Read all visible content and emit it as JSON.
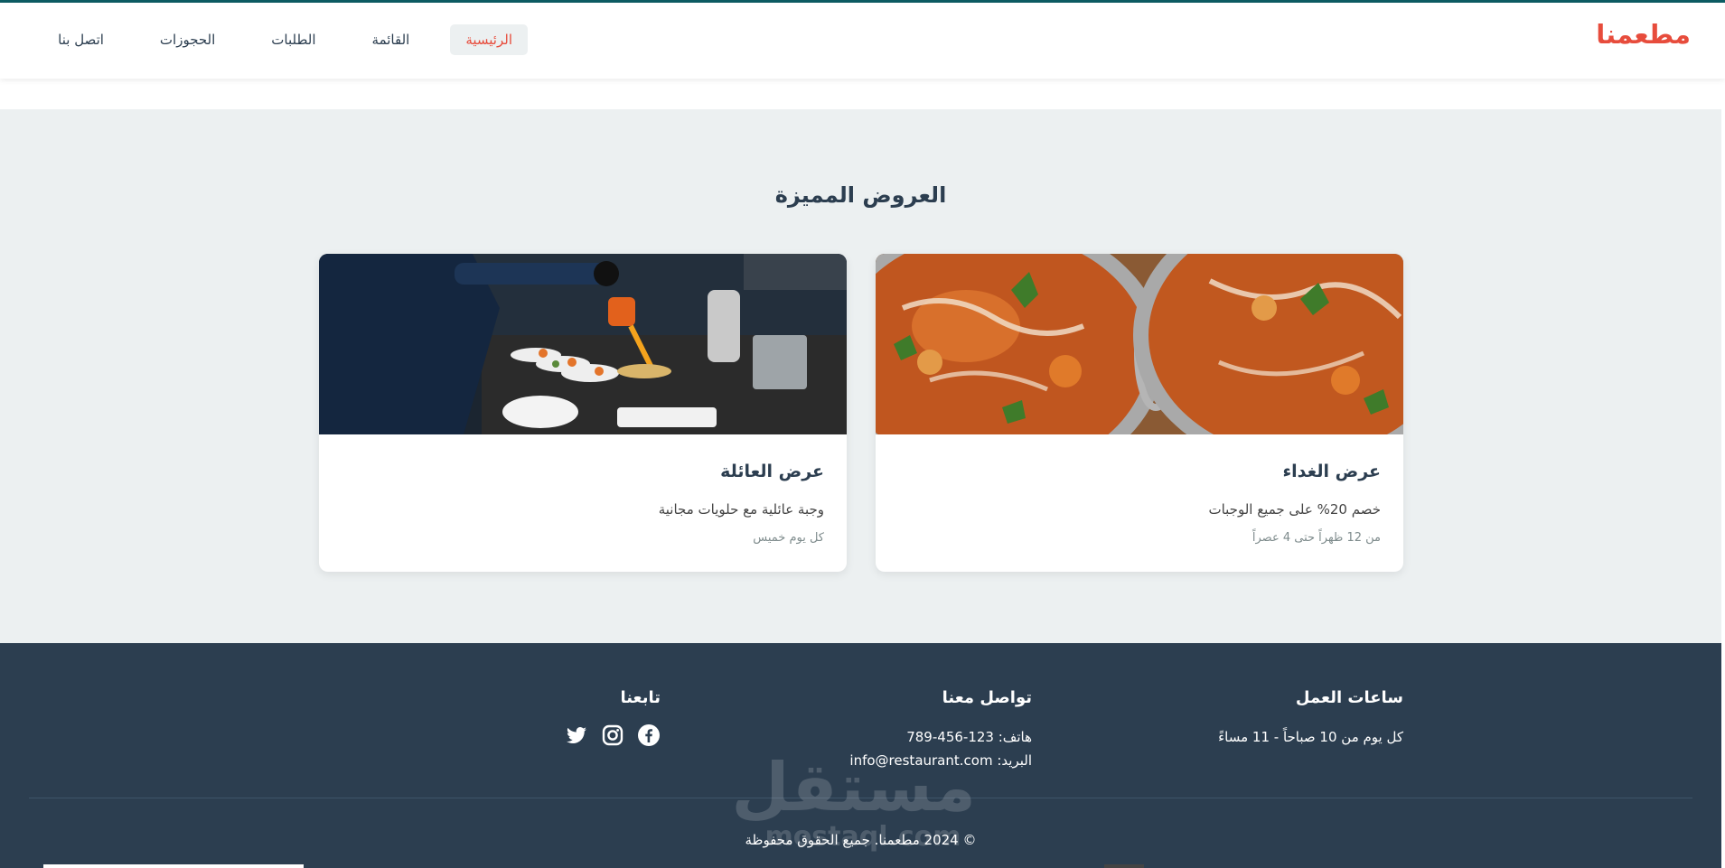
{
  "header": {
    "logo": "مطعمنا",
    "nav": [
      {
        "label": "الرئيسية",
        "active": true
      },
      {
        "label": "القائمة",
        "active": false
      },
      {
        "label": "الطلبات",
        "active": false
      },
      {
        "label": "الحجوزات",
        "active": false
      },
      {
        "label": "اتصل بنا",
        "active": false
      }
    ]
  },
  "offers": {
    "title": "العروض المميزة",
    "cards": [
      {
        "title": "عرض الغداء",
        "description": "خصم 20% على جميع الوجبات",
        "time": "من 12 ظهراً حتى 4 عصراً",
        "image": "curry-dishes"
      },
      {
        "title": "عرض العائلة",
        "description": "وجبة عائلية مع حلويات مجانية",
        "time": "كل يوم خميس",
        "image": "chef-kitchen"
      }
    ]
  },
  "footer": {
    "hours": {
      "title": "ساعات العمل",
      "text": "كل يوم من 10 صباحاً - 11 مساءً"
    },
    "contact": {
      "title": "تواصل معنا",
      "phone": "هاتف: 123-456-789",
      "email": "البريد: info@restaurant.com"
    },
    "follow": {
      "title": "تابعنا",
      "icons": [
        "facebook-icon",
        "instagram-icon",
        "twitter-icon"
      ]
    },
    "copyright": "© 2024 مطعمنا. جميع الحقوق محفوظة"
  },
  "watermark": {
    "arabic": "مستقل",
    "latin": "mostaql.com"
  },
  "colors": {
    "brand": "#e74c3c",
    "footer_bg": "#2c3e50",
    "page_bg": "#ecf0f1",
    "text": "#2c3e50"
  }
}
